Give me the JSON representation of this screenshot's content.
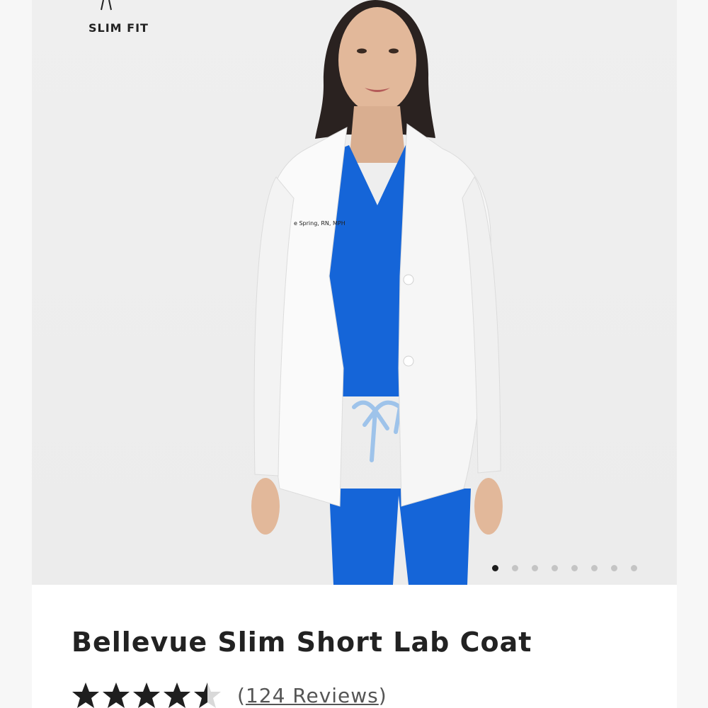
{
  "gallery": {
    "fit_badge": {
      "label": "SLIM FIT",
      "icon": "body-silhouette-icon"
    },
    "image": {
      "subject": "model-in-white-lab-coat",
      "embroidery_text": "e Spring, RN, MPH"
    },
    "pagination": {
      "total": 8,
      "active_index": 0
    }
  },
  "product": {
    "title": "Bellevue Slim Short Lab Coat",
    "rating": {
      "value": 4.5,
      "max": 5,
      "reviews_label": "124 Reviews",
      "open_paren": "(",
      "close_paren": ")"
    }
  },
  "colors": {
    "scrubs_blue": "#1565d8",
    "coat_white": "#fafafa",
    "text_dark": "#222222",
    "dot_active": "#1c1c1c",
    "dot_inactive": "#c4c4c4"
  }
}
